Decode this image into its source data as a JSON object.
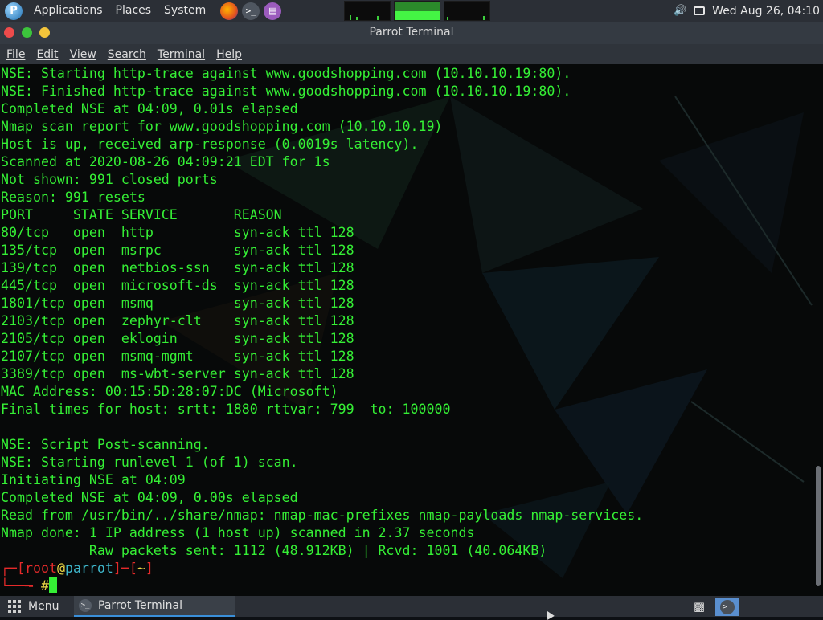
{
  "top_panel": {
    "menus": [
      "Applications",
      "Places",
      "System"
    ],
    "clock": "Wed Aug 26, 04:10",
    "icons": [
      "parrot-logo-icon",
      "firefox-icon",
      "terminal-icon",
      "text-editor-icon",
      "volume-icon",
      "screen-icon"
    ]
  },
  "window": {
    "title": "Parrot Terminal"
  },
  "menubar": [
    "File",
    "Edit",
    "View",
    "Search",
    "Terminal",
    "Help"
  ],
  "terminal": {
    "lines": [
      "NSE: Starting http-trace against www.goodshopping.com (10.10.10.19:80).",
      "NSE: Finished http-trace against www.goodshopping.com (10.10.10.19:80).",
      "Completed NSE at 04:09, 0.01s elapsed",
      "Nmap scan report for www.goodshopping.com (10.10.10.19)",
      "Host is up, received arp-response (0.0019s latency).",
      "Scanned at 2020-08-26 04:09:21 EDT for 1s",
      "Not shown: 991 closed ports",
      "Reason: 991 resets",
      "PORT     STATE SERVICE       REASON",
      "80/tcp   open  http          syn-ack ttl 128",
      "135/tcp  open  msrpc         syn-ack ttl 128",
      "139/tcp  open  netbios-ssn   syn-ack ttl 128",
      "445/tcp  open  microsoft-ds  syn-ack ttl 128",
      "1801/tcp open  msmq          syn-ack ttl 128",
      "2103/tcp open  zephyr-clt    syn-ack ttl 128",
      "2105/tcp open  eklogin       syn-ack ttl 128",
      "2107/tcp open  msmq-mgmt     syn-ack ttl 128",
      "3389/tcp open  ms-wbt-server syn-ack ttl 128",
      "MAC Address: 00:15:5D:28:07:DC (Microsoft)",
      "Final times for host: srtt: 1880 rttvar: 799  to: 100000",
      "",
      "NSE: Script Post-scanning.",
      "NSE: Starting runlevel 1 (of 1) scan.",
      "Initiating NSE at 04:09",
      "Completed NSE at 04:09, 0.00s elapsed",
      "Read from /usr/bin/../share/nmap: nmap-mac-prefixes nmap-payloads nmap-services.",
      "Nmap done: 1 IP address (1 host up) scanned in 2.37 seconds",
      "           Raw packets sent: 1112 (48.912KB) | Rcvd: 1001 (40.064KB)"
    ],
    "prompt": {
      "open": "┌─[",
      "user": "root",
      "at": "@",
      "host": "parrot",
      "mid": "]─[",
      "dir": "~",
      "close": "]",
      "line2": "└──╼ ",
      "symbol": "#"
    }
  },
  "bottom_panel": {
    "menu_label": "Menu",
    "task_label": "Parrot Terminal"
  },
  "colors": {
    "terminal_text": "#35ef35",
    "prompt_red": "#e52a2a",
    "prompt_cyan": "#3fb8cc",
    "panel_bg": "#2b2f36"
  }
}
